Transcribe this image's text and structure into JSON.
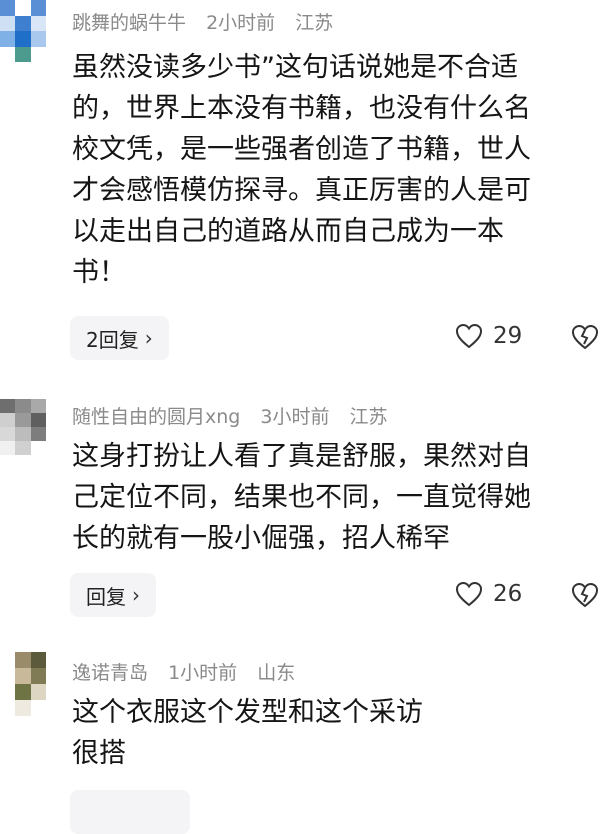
{
  "comments": [
    {
      "username": "跳舞的蜗牛牛",
      "time": "2小时前",
      "location": "江苏",
      "lines": [
        "虽然没读多少书”这句话说她是不合适",
        "的，世界上本没有书籍，也没有什么名",
        "校文凭，是一些强者创造了书籍，世人",
        "才会感悟模仿探寻。真正厉害的人是可",
        "以走出自己的道路从而自己成为一本",
        "书！"
      ],
      "reply_label": "2回复",
      "like_count": "29"
    },
    {
      "username": "随性自由的圆月xng",
      "time": "3小时前",
      "location": "江苏",
      "lines": [
        "这身打扮让人看了真是舒服，果然对自",
        "己定位不同，结果也不同，一直觉得她",
        "长的就有一股小倔强，招人稀罕"
      ],
      "reply_label": "回复",
      "like_count": "26"
    },
    {
      "username": "逸诺青岛",
      "time": "1小时前",
      "location": "山东",
      "lines": [
        "这个衣服这个发型和这个采访",
        "很搭"
      ]
    }
  ],
  "icons": {
    "reply_chevron": "chevron-right-icon",
    "like": "heart-icon",
    "dislike": "broken-heart-icon"
  },
  "colors": {
    "meta_text": "#8a8a8a",
    "reply_bg": "#f4f4f6"
  }
}
